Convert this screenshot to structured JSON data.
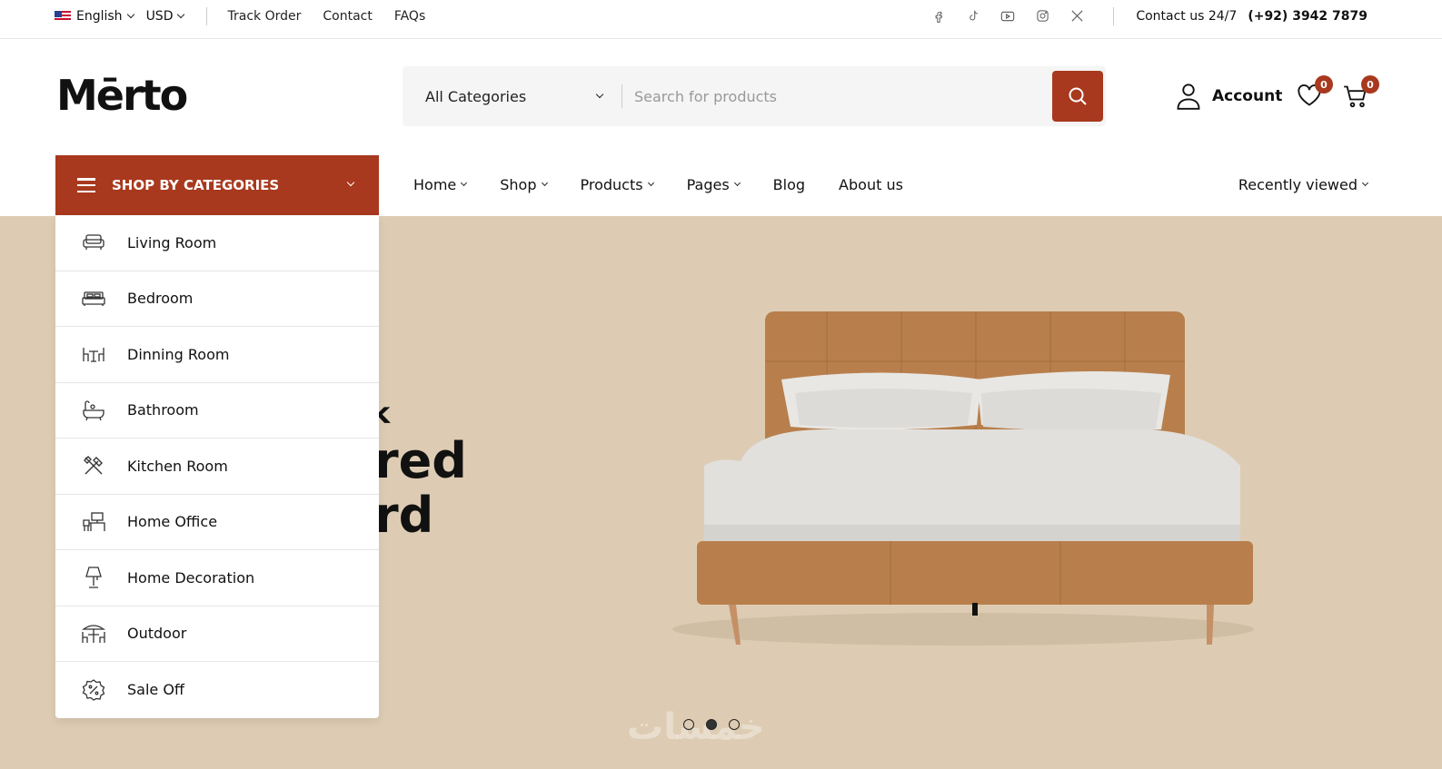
{
  "topbar": {
    "language": "English",
    "currency": "USD",
    "links": [
      "Track Order",
      "Contact",
      "FAQs"
    ],
    "social_icons": [
      "facebook-icon",
      "tiktok-icon",
      "youtube-icon",
      "instagram-icon",
      "x-icon"
    ],
    "contact_label": "Contact us 24/7",
    "phone": "(+92) 3942 7879"
  },
  "header": {
    "logo": "Mērto",
    "category_select": "All Categories",
    "search_placeholder": "Search for products",
    "account_label": "Account",
    "wishlist_count": "0",
    "cart_count": "0"
  },
  "nav": {
    "categories_button": "SHOP BY CATEGORIES",
    "items": [
      "Home",
      "Shop",
      "Products",
      "Pages",
      "Blog",
      "About us"
    ],
    "recently_viewed": "Recently viewed"
  },
  "categories": [
    {
      "label": "Living Room",
      "icon": "sofa-icon"
    },
    {
      "label": "Bedroom",
      "icon": "bed-icon"
    },
    {
      "label": "Dinning Room",
      "icon": "dining-table-icon"
    },
    {
      "label": "Bathroom",
      "icon": "bathtub-icon"
    },
    {
      "label": "Kitchen Room",
      "icon": "kitchen-tools-icon"
    },
    {
      "label": "Home Office",
      "icon": "office-desk-icon"
    },
    {
      "label": "Home Decoration",
      "icon": "lamp-icon"
    },
    {
      "label": "Outdoor",
      "icon": "outdoor-table-icon"
    },
    {
      "label": "Sale Off",
      "icon": "discount-badge-icon"
    }
  ],
  "hero": {
    "subtitle_fragment": "k",
    "title_line1_fragment": "red",
    "title_line2_fragment": "rd",
    "slide_count": 3,
    "active_slide": 2
  },
  "colors": {
    "accent": "#a8391e",
    "hero_bg": "#ddccb3"
  }
}
